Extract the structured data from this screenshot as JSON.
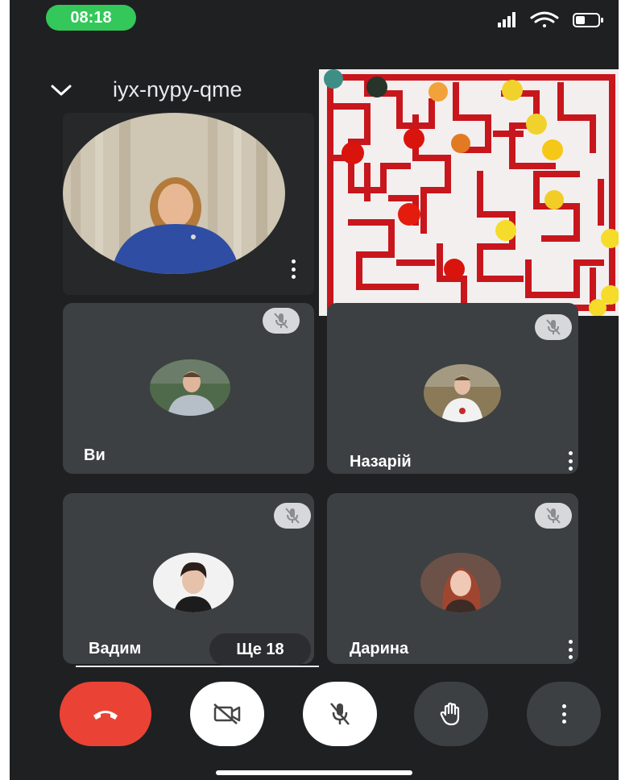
{
  "status_bar": {
    "time": "08:18",
    "signal_icon": "cellular-signal-icon",
    "wifi_icon": "wifi-icon",
    "battery_icon": "battery-icon"
  },
  "header": {
    "collapse_icon": "chevron-down-icon",
    "meeting_code": "iyx-nypy-qme"
  },
  "participants": [
    {
      "name": "Ви",
      "muted": true
    },
    {
      "name": "Назарій",
      "muted": true
    },
    {
      "name": "Вадим",
      "muted": true
    },
    {
      "name": "Дарина",
      "muted": true
    }
  ],
  "more_participants": "Ще 18",
  "controls": {
    "end_call_icon": "phone-hangup-icon",
    "camera_icon": "camera-off-icon",
    "mic_icon": "mic-off-icon",
    "hand_icon": "raise-hand-icon",
    "more_icon": "more-vert-icon"
  },
  "colors": {
    "background": "#1f2022",
    "tile": "#3c4043",
    "end_call": "#ea4335",
    "time_pill": "#34c759",
    "maze": "#c8161d"
  }
}
